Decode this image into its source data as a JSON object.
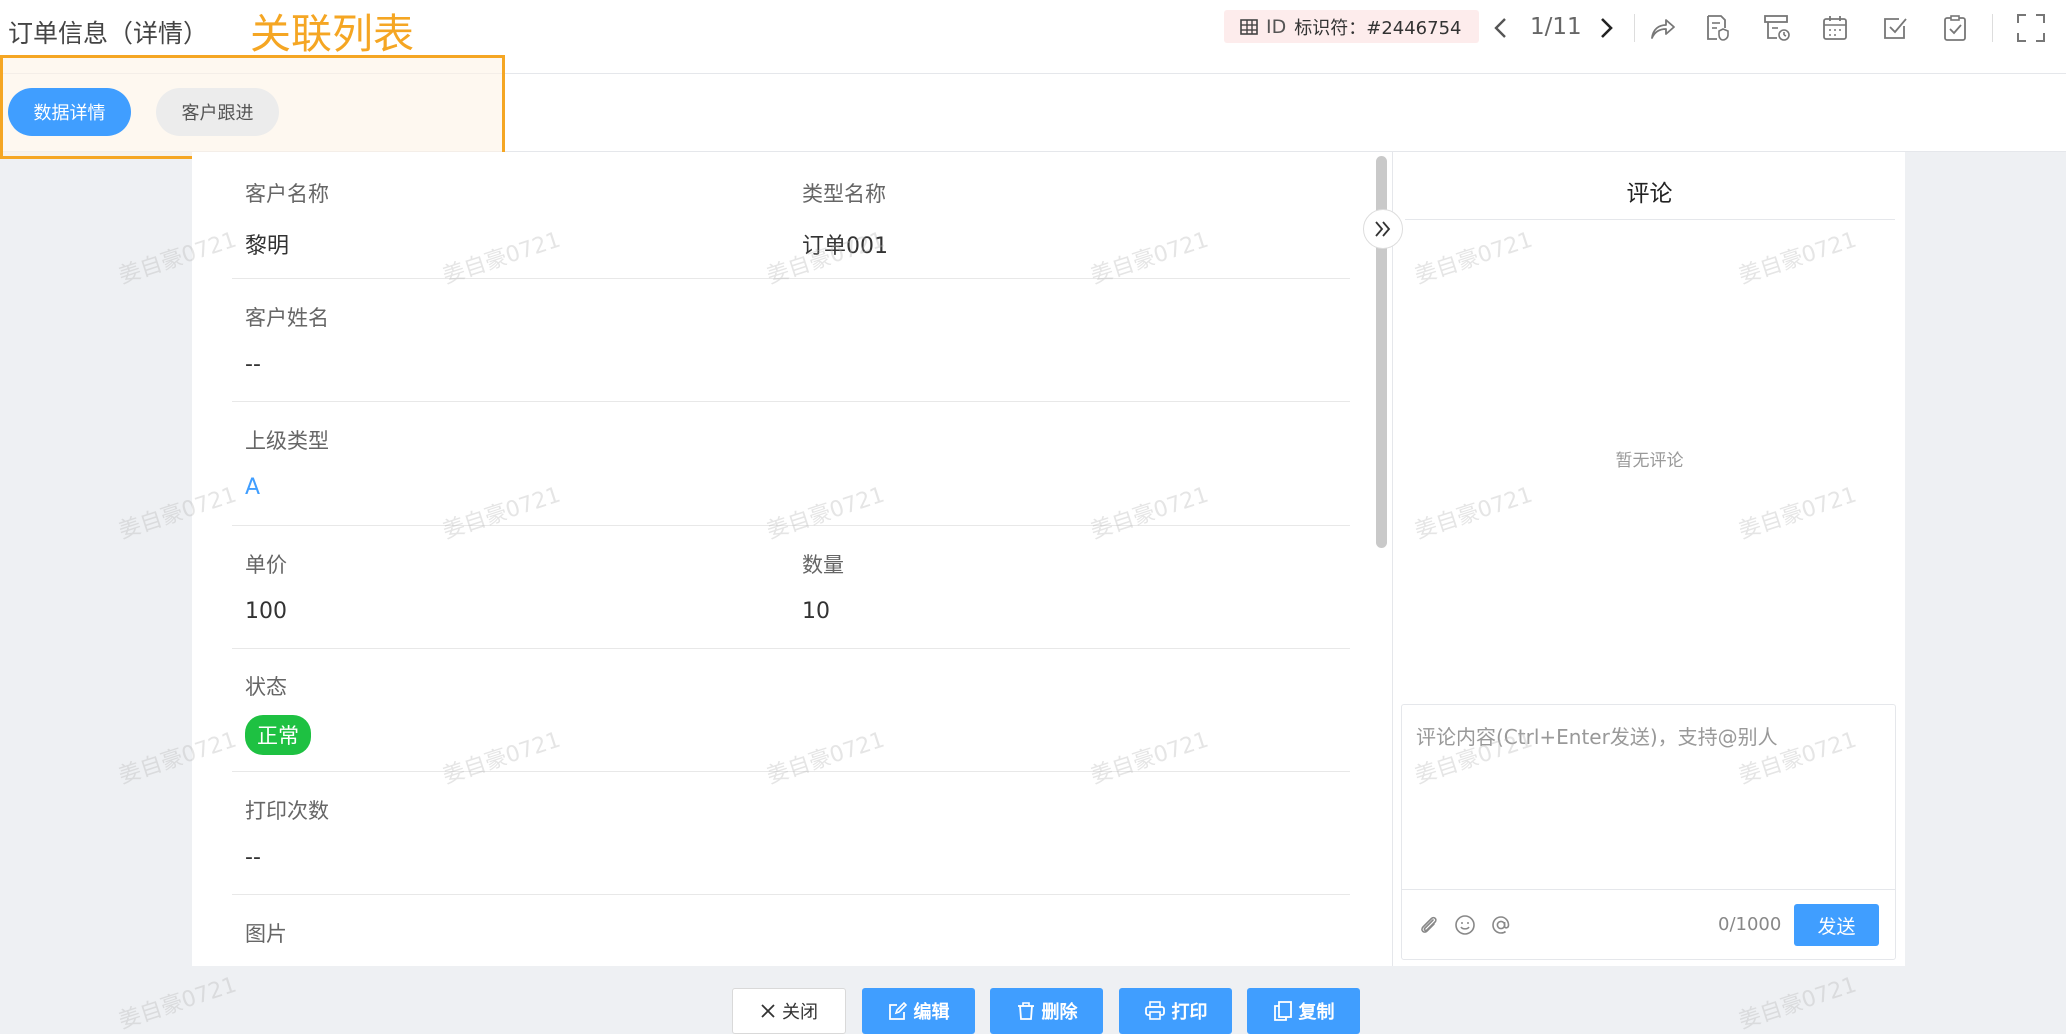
{
  "header": {
    "title": "订单信息（详情）",
    "annotation_label": "关联列表",
    "id_chip": {
      "prefix": "ID",
      "text": "标识符：#2446754"
    },
    "pager": "1/11",
    "toolbar_icons": [
      "share-icon",
      "document-shield-icon",
      "workflow-icon",
      "calendar-icon",
      "checkbox-icon",
      "clipboard-check-icon",
      "fullscreen-icon"
    ]
  },
  "tabs": [
    {
      "label": "数据详情",
      "active": true
    },
    {
      "label": "客户跟进",
      "active": false
    }
  ],
  "fields": {
    "customer_name": {
      "label": "客户名称",
      "value": "黎明"
    },
    "type_name": {
      "label": "类型名称",
      "value": "订单001"
    },
    "customer_full_name": {
      "label": "客户姓名",
      "value": "--"
    },
    "parent_type": {
      "label": "上级类型",
      "value": "A"
    },
    "unit_price": {
      "label": "单价",
      "value": "100"
    },
    "quantity": {
      "label": "数量",
      "value": "10"
    },
    "status": {
      "label": "状态",
      "value": "正常"
    },
    "print_count": {
      "label": "打印次数",
      "value": "--"
    },
    "image": {
      "label": "图片"
    }
  },
  "comments": {
    "title": "评论",
    "empty_text": "暂无评论",
    "placeholder": "评论内容(Ctrl+Enter发送)，支持@别人",
    "count": "0/1000",
    "send_label": "发送"
  },
  "footer": {
    "close": "关闭",
    "edit": "编辑",
    "delete": "删除",
    "print": "打印",
    "copy": "复制"
  },
  "watermark": "姜自豪0721",
  "colors": {
    "primary": "#409eff",
    "annotation": "#f5a623",
    "status_green": "#1ec142",
    "id_chip_bg": "#fdecec"
  }
}
